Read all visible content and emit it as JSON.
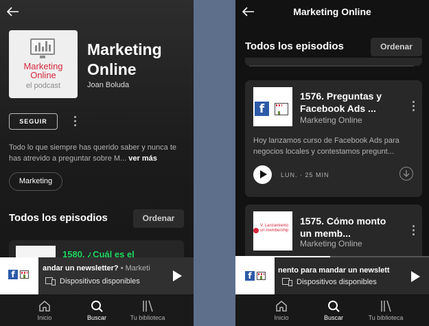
{
  "left": {
    "cover": {
      "line1": "Marketing",
      "line2": "Online",
      "line3": "el podcast"
    },
    "show_title": "Marketing Online",
    "author": "Joan Boluda",
    "follow_label": "SEGUIR",
    "description": "Todo lo que siempre has querido saber y nunca te has atrevido a preguntar sobre M...",
    "see_more": "ver más",
    "category": "Marketing",
    "episodes_heading": "Todos los episodios",
    "sort_label": "Ordenar",
    "peek_episode_title": "1580. ¿Cuál es el"
  },
  "right": {
    "header_title": "Marketing Online",
    "episodes_heading": "Todos los episodios",
    "sort_label": "Ordenar",
    "episodes": [
      {
        "title": "1576. Preguntas y Facebook Ads ...",
        "show": "Marketing Online",
        "description": "Hoy lanzamos curso de Facebook Ads para negocios locales y contestamos pregunt...",
        "meta": "LUN. · 25 MIN"
      },
      {
        "title": "1575. Cómo monto un memb...",
        "show": "Marketing Online",
        "thumb_text": "V. Lanzamiento un membership"
      }
    ]
  },
  "mini_player_left": {
    "track": "andar un newsletter?",
    "separator": " • ",
    "artist": "Marketi",
    "devices": "Dispositivos disponibles",
    "progress": 0
  },
  "mini_player_right": {
    "track": "nento para mandar un newslett",
    "devices": "Dispositivos disponibles",
    "progress": 0.49
  },
  "nav": {
    "home": "Inicio",
    "search": "Buscar",
    "library": "Tu biblioteca"
  },
  "colors": {
    "accent_green": "#1ed760",
    "brand_red": "#d7283e",
    "facebook_blue": "#2d5aa8"
  },
  "icons": {
    "back": "back-arrow-icon",
    "more": "kebab-menu-icon",
    "play": "play-icon",
    "download": "download-icon",
    "devices": "devices-icon",
    "home": "home-icon",
    "search": "search-icon",
    "library": "library-icon"
  }
}
